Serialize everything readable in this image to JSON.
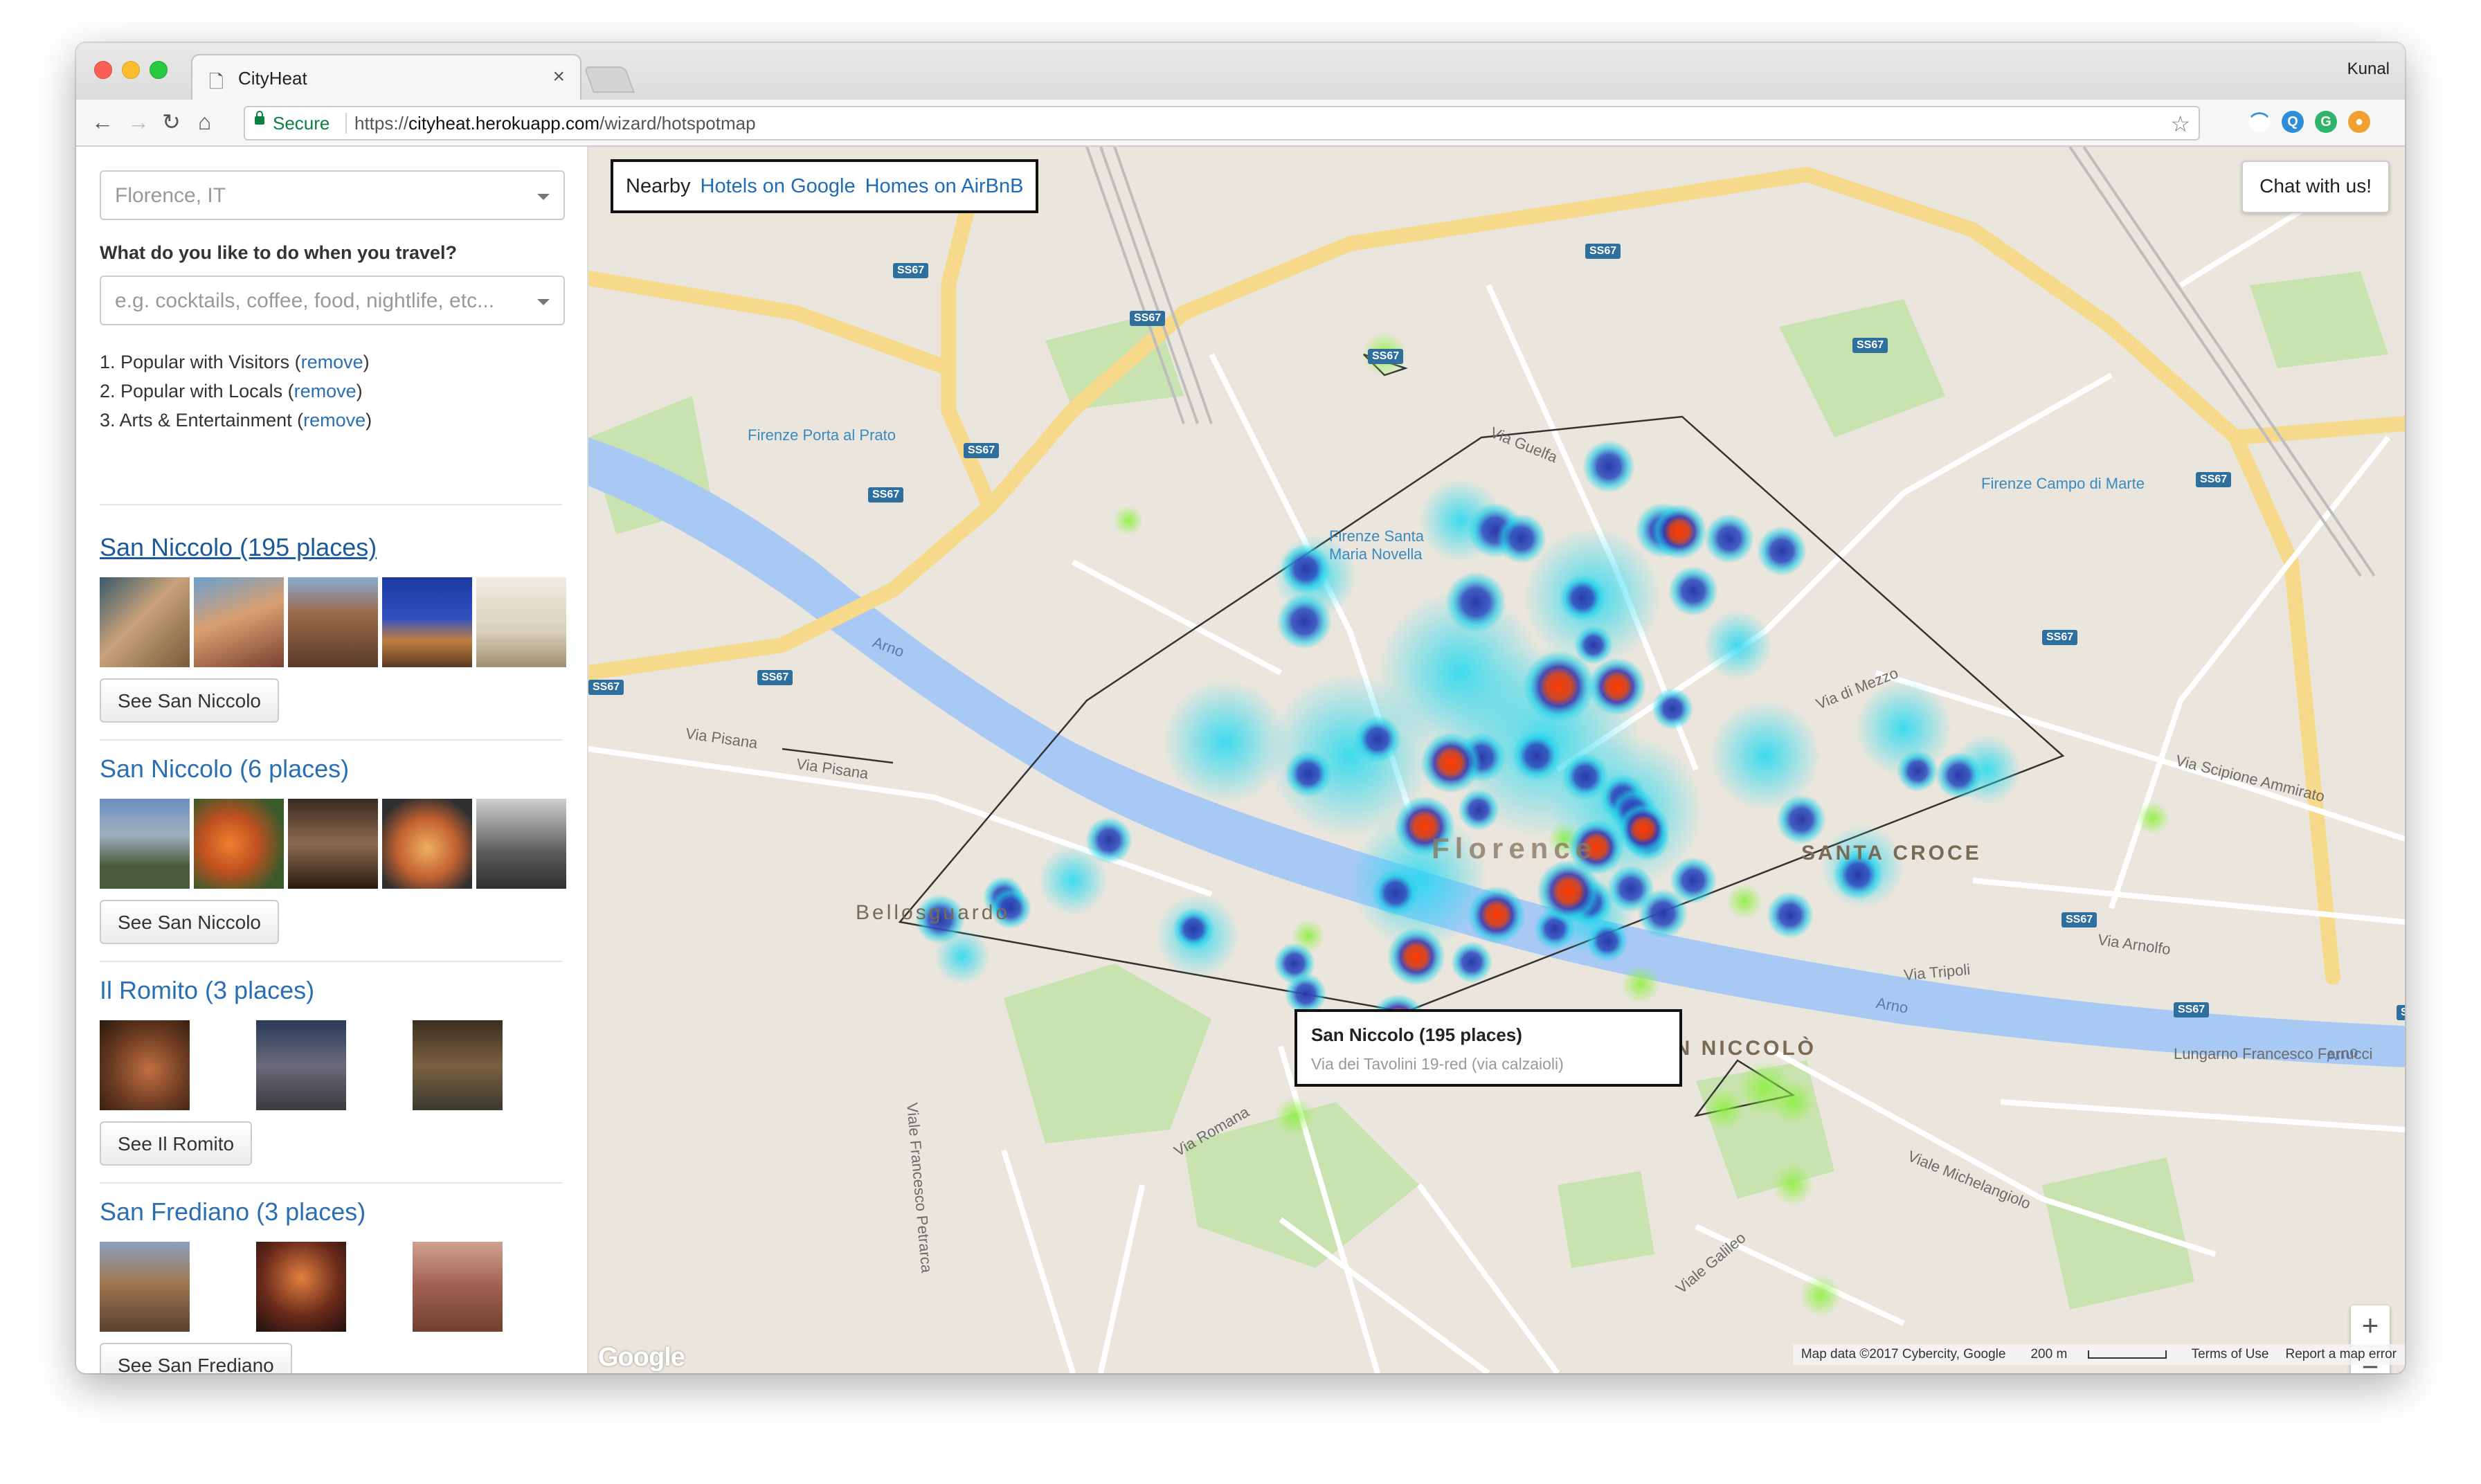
{
  "browser": {
    "tab_title": "CityHeat",
    "user_name": "Kunal",
    "secure_label": "Secure",
    "url_scheme": "https://",
    "url_host": "cityheat.herokuapp.com",
    "url_path": "/wizard/hotspotmap"
  },
  "sidebar": {
    "city_value": "Florence, IT",
    "question": "What do you like to do when you travel?",
    "interests_placeholder": "e.g. cocktails, coffee, food, nightlife, etc...",
    "preferences": [
      {
        "prefix": "1. Popular with Visitors (",
        "link": "remove",
        "suffix": ")"
      },
      {
        "prefix": "2. Popular with Locals (",
        "link": "remove",
        "suffix": ")"
      },
      {
        "prefix": "3. Arts & Entertainment (",
        "link": "remove",
        "suffix": ")"
      }
    ],
    "groups": [
      {
        "title": "San Niccolo (195 places)",
        "button": "See San Niccolo"
      },
      {
        "title": "San Niccolo (6 places)",
        "button": "See San Niccolo"
      },
      {
        "title": "Il Romito (3 places)",
        "button": "See Il Romito"
      },
      {
        "title": "San Frediano (3 places)",
        "button": "See San Frediano"
      }
    ]
  },
  "map": {
    "nearby_label": "Nearby",
    "hotels_link": "Hotels on Google",
    "airbnb_link": "Homes on AirBnB",
    "chat_button": "Chat with us!",
    "tooltip_title": "San Niccolo (195 places)",
    "tooltip_address": "Via dei Tavolini 19-red (via calzaioli)",
    "zoom_in": "+",
    "zoom_out": "−",
    "google_logo": "Google",
    "attribution": "Map data ©2017 Cybercity, Google",
    "scale_label": "200 m",
    "terms": "Terms of Use",
    "report": "Report a map error",
    "labels": {
      "florence": "Florence",
      "santa_croce": "SANTA CROCE",
      "bellosguardo": "Bellosguardo",
      "san_niccolo": "SAN NICCOLÒ",
      "arno": "Arno",
      "porta_al_prato": "Firenze Porta al Prato",
      "smn": "Firenze Santa Maria Novella",
      "campo_di_marte": "Firenze Campo di Marte",
      "via_pisana": "Via Pisana",
      "via_guelfa": "Via Guelfa",
      "lungarno_ferrucci": "Lungarno Francesco Ferrucci",
      "viale_petrarca": "Viale Francesco Petrarca",
      "via_romana": "Via Romana",
      "viale_michelangiolo": "Viale Michelangiolo",
      "via_arnolfo": "Via Arnolfo",
      "via_scipione": "Via Scipione Ammirato",
      "viale_galileo": "Viale Galileo",
      "via_di_mezzo": "Via di Mezzo",
      "via_tripoli": "Via Tripoli",
      "ss67": "SS67"
    }
  }
}
